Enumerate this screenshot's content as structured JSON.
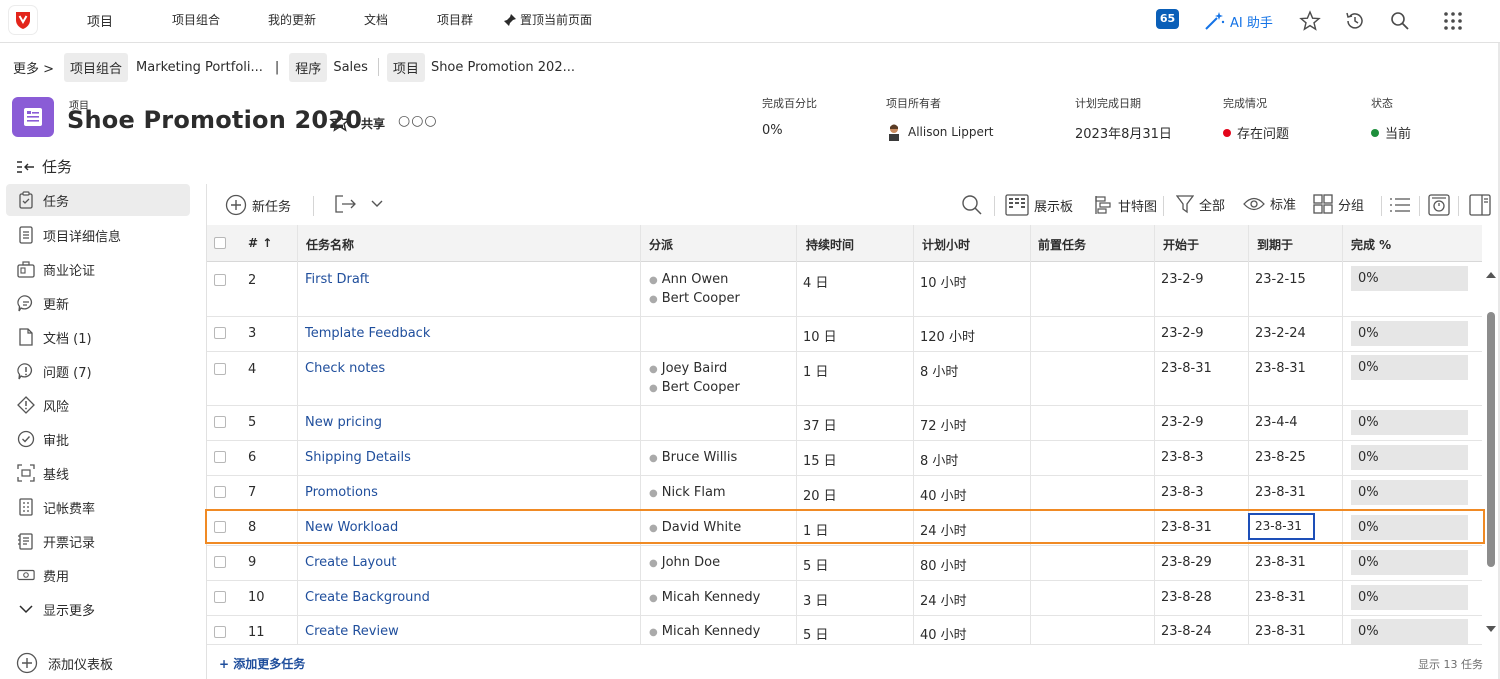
{
  "nav": {
    "items": [
      "项目",
      "项目组合",
      "我的更新",
      "文档",
      "项目群"
    ],
    "pin_label": "置顶当前页面",
    "notification_count": "65",
    "ai_label": "AI 助手"
  },
  "breadcrumb": {
    "more": "更多 >",
    "portfolio_tag": "项目组合",
    "portfolio_name": "Marketing Portfoli...",
    "sep": "|",
    "program_tag": "程序",
    "program_name": "Sales",
    "project_tag": "项目",
    "project_name": "Shoe Promotion 202..."
  },
  "project": {
    "kind": "项目",
    "title": "Shoe Promotion 2020",
    "share_label": "共享",
    "more": "○○○",
    "meta": [
      {
        "label": "完成百分比",
        "value": "0%"
      },
      {
        "label": "项目所有者",
        "value": "Allison Lippert"
      },
      {
        "label": "计划完成日期",
        "value": "2023年8月31日"
      },
      {
        "label": "完成情况",
        "value": "存在问题",
        "dot_color": "#e3051b"
      },
      {
        "label": "状态",
        "value": "当前",
        "dot_color": "#1e8f3c"
      }
    ]
  },
  "section_title": "任务",
  "sidebar": {
    "items": [
      {
        "label": "任务",
        "icon": "clipboard-icon"
      },
      {
        "label": "项目详细信息",
        "icon": "document-icon"
      },
      {
        "label": "商业论证",
        "icon": "business-case-icon"
      },
      {
        "label": "更新",
        "icon": "chat-icon"
      },
      {
        "label": "文档 (1)",
        "icon": "file-icon"
      },
      {
        "label": "问题 (7)",
        "icon": "issue-icon"
      },
      {
        "label": "风险",
        "icon": "risk-icon"
      },
      {
        "label": "审批",
        "icon": "approval-icon"
      },
      {
        "label": "基线",
        "icon": "baseline-icon"
      },
      {
        "label": "记帐费率",
        "icon": "billing-rates-icon"
      },
      {
        "label": "开票记录",
        "icon": "billing-records-icon"
      },
      {
        "label": "费用",
        "icon": "expense-icon"
      },
      {
        "label": "显示更多",
        "icon": "chevron-down-icon"
      }
    ],
    "add_dashboard": "添加仪表板"
  },
  "toolbar": {
    "new_task": "新任务",
    "board": "展示板",
    "gantt": "甘特图",
    "filter": "全部",
    "view": "标准",
    "group": "分组"
  },
  "table": {
    "headers": {
      "num": "# ↑",
      "name": "任务名称",
      "assign": "分派",
      "duration": "持续时间",
      "planned_hours": "计划小时",
      "predecessors": "前置任务",
      "start": "开始于",
      "due": "到期于",
      "pct": "完成 %"
    },
    "rows": [
      {
        "num": "2",
        "name": "First Draft",
        "assignees": [
          "Ann Owen",
          "Bert Cooper"
        ],
        "duration": "4 日",
        "hours": "10 小时",
        "start": "23-2-9",
        "due": "23-2-15",
        "pct": "0%"
      },
      {
        "num": "3",
        "name": "Template Feedback",
        "assignees": [],
        "duration": "10 日",
        "hours": "120 小时",
        "start": "23-2-9",
        "due": "23-2-24",
        "pct": "0%"
      },
      {
        "num": "4",
        "name": "Check notes",
        "assignees": [
          "Joey Baird",
          "Bert Cooper"
        ],
        "duration": "1 日",
        "hours": "8 小时",
        "start": "23-8-31",
        "due": "23-8-31",
        "pct": "0%"
      },
      {
        "num": "5",
        "name": "New pricing",
        "assignees": [],
        "duration": "37 日",
        "hours": "72 小时",
        "start": "23-2-9",
        "due": "23-4-4",
        "pct": "0%"
      },
      {
        "num": "6",
        "name": "Shipping Details",
        "assignees": [
          "Bruce Willis"
        ],
        "duration": "15 日",
        "hours": "8 小时",
        "start": "23-8-3",
        "due": "23-8-25",
        "pct": "0%"
      },
      {
        "num": "7",
        "name": "Promotions",
        "assignees": [
          "Nick Flam"
        ],
        "duration": "20 日",
        "hours": "40 小时",
        "start": "23-8-3",
        "due": "23-8-31",
        "pct": "0%"
      },
      {
        "num": "8",
        "name": "New Workload",
        "assignees": [
          "David White"
        ],
        "duration": "1 日",
        "hours": "24 小时",
        "start": "23-8-31",
        "due": "23-8-31",
        "pct": "0%"
      },
      {
        "num": "9",
        "name": "Create Layout",
        "assignees": [
          "John Doe"
        ],
        "duration": "5 日",
        "hours": "80 小时",
        "start": "23-8-29",
        "due": "23-8-31",
        "pct": "0%"
      },
      {
        "num": "10",
        "name": "Create Background",
        "assignees": [
          "Micah Kennedy"
        ],
        "duration": "3 日",
        "hours": "24 小时",
        "start": "23-8-28",
        "due": "23-8-31",
        "pct": "0%"
      },
      {
        "num": "11",
        "name": "Create Review",
        "assignees": [
          "Micah Kennedy"
        ],
        "duration": "5 日",
        "hours": "40 小时",
        "start": "23-8-24",
        "due": "23-8-31",
        "pct": "0%"
      }
    ]
  },
  "footer": {
    "add_more": "+ 添加更多任务",
    "count": "显示 13 任务"
  }
}
